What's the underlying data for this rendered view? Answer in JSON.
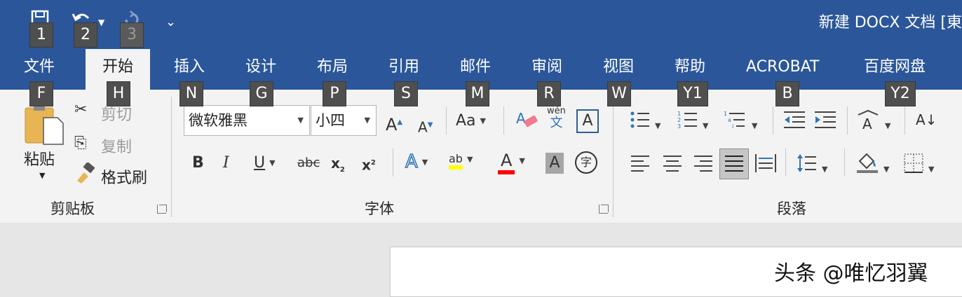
{
  "quick_access": {
    "keytips": [
      "1",
      "2",
      "3"
    ],
    "customize": "⌄"
  },
  "doc_title": "新建 DOCX 文档 [東",
  "tabs": [
    {
      "label": "文件",
      "keytip": "F"
    },
    {
      "label": "开始",
      "keytip": "H",
      "active": true
    },
    {
      "label": "插入",
      "keytip": "N"
    },
    {
      "label": "设计",
      "keytip": "G"
    },
    {
      "label": "布局",
      "keytip": "P"
    },
    {
      "label": "引用",
      "keytip": "S"
    },
    {
      "label": "邮件",
      "keytip": "M"
    },
    {
      "label": "审阅",
      "keytip": "R"
    },
    {
      "label": "视图",
      "keytip": "W"
    },
    {
      "label": "帮助",
      "keytip": "Y1"
    },
    {
      "label": "ACROBAT",
      "keytip": "B"
    },
    {
      "label": "百度网盘",
      "keytip": "Y2"
    }
  ],
  "clipboard": {
    "paste": "粘贴",
    "cut": "剪切",
    "copy": "复制",
    "format_painter": "格式刷",
    "group_label": "剪贴板"
  },
  "font": {
    "font_name": "微软雅黑",
    "font_size": "小四",
    "grow": "A",
    "shrink": "A",
    "change_case": "Aa",
    "phonetic_top": "wén",
    "phonetic_bottom": "文",
    "border_char": "A",
    "bold": "B",
    "italic": "I",
    "underline": "U",
    "strikethrough": "abc",
    "subscript": "x",
    "superscript": "x",
    "effects": "A",
    "highlight": "ab",
    "font_color": "A",
    "shading": "A",
    "enclose": "字",
    "group_label": "字体"
  },
  "paragraph": {
    "sort": "A↓",
    "group_label": "段落"
  },
  "watermark": "头条 @唯忆羽翼",
  "colors": {
    "title_bar": "#2b579a",
    "highlight_yellow": "#ffff00",
    "font_red": "#ff0000",
    "accent_blue": "#2e75b6"
  }
}
